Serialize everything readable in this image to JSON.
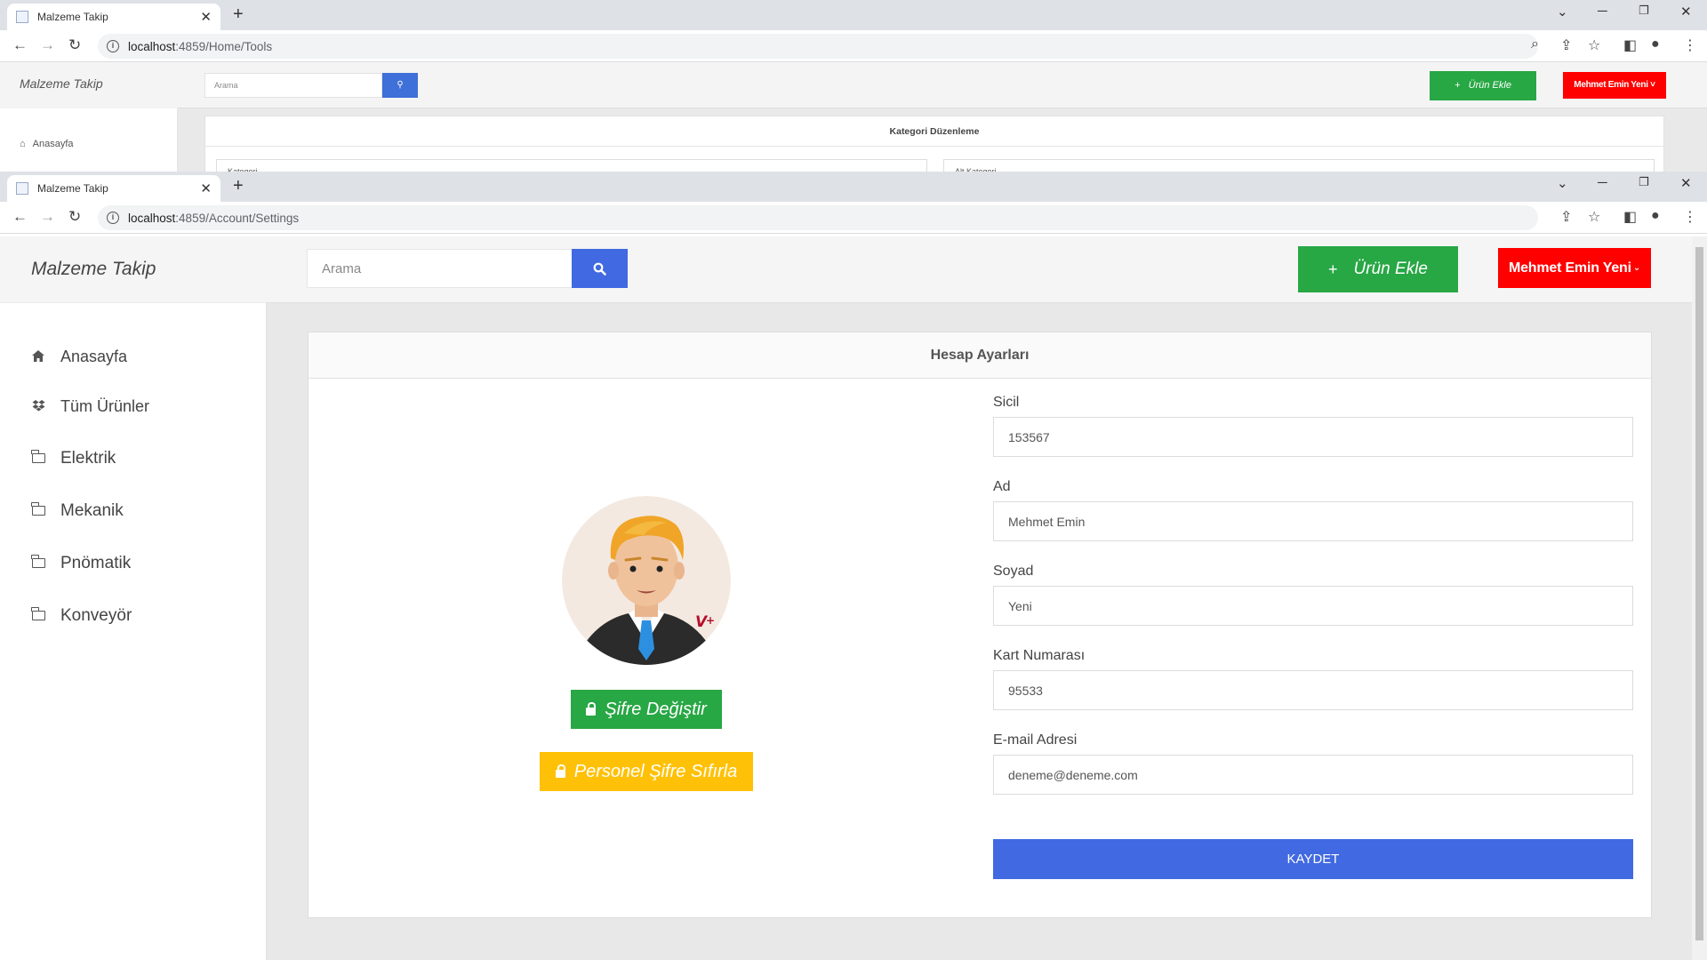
{
  "back_window": {
    "tab_title": "Malzeme Takip",
    "url_host": "localhost",
    "url_path": ":4859/Home/Tools",
    "brand": "Malzeme Takip",
    "nav_home": "Anasayfa",
    "search_placeholder": "Arama",
    "add_label": "Ürün Ekle",
    "user_label": "Mehmet Emin Yeni",
    "card_title": "Kategori Düzenleme",
    "field1": "Kategori",
    "field2": "Alt Kategori"
  },
  "browser": {
    "tab_title": "Malzeme Takip",
    "url_host": "localhost",
    "url_path": ":4859/Account/Settings"
  },
  "app": {
    "brand": "Malzeme Takip",
    "search_placeholder": "Arama",
    "add_product_label": "Ürün Ekle",
    "user_menu_label": "Mehmet Emin Yeni",
    "sidebar": {
      "items": [
        {
          "label": "Anasayfa",
          "icon": "home-icon"
        },
        {
          "label": "Tüm Ürünler",
          "icon": "dropbox-icon"
        },
        {
          "label": "Elektrik",
          "icon": "folder-icon"
        },
        {
          "label": "Mekanik",
          "icon": "folder-icon"
        },
        {
          "label": "Pnömatik",
          "icon": "folder-icon"
        },
        {
          "label": "Konveyör",
          "icon": "folder-icon"
        }
      ]
    },
    "card": {
      "title": "Hesap Ayarları",
      "change_password_label": "Şifre Değiştir",
      "reset_password_label": "Personel Şifre Sıfırla",
      "fields": {
        "sicil": {
          "label": "Sicil",
          "value": "153567"
        },
        "ad": {
          "label": "Ad",
          "value": "Mehmet Emin"
        },
        "soyad": {
          "label": "Soyad",
          "value": "Yeni"
        },
        "kart": {
          "label": "Kart Numarası",
          "value": "95533"
        },
        "email": {
          "label": "E-mail Adresi",
          "value": "deneme@deneme.com"
        }
      },
      "save_label": "KAYDET"
    }
  },
  "colors": {
    "primary": "#4169e1",
    "success": "#28a745",
    "danger": "#ff0000",
    "warning": "#ffc107"
  }
}
